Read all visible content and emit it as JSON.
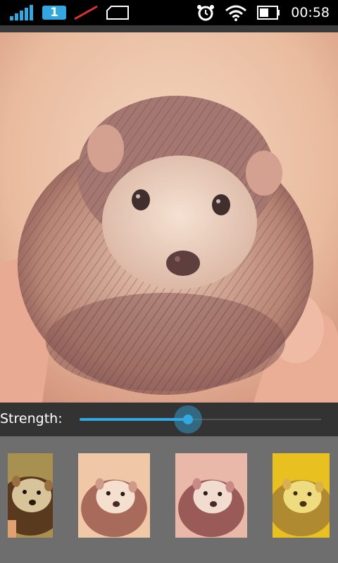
{
  "status_bar": {
    "sim_slot": "1",
    "time": "00:58",
    "icons": [
      "signal-bars-icon",
      "sim-1-icon",
      "mobile-data-off-icon",
      "sim-card-icon",
      "alarm-clock-icon",
      "wifi-icon",
      "battery-icon"
    ]
  },
  "editor": {
    "strength_label": "Strength:",
    "strength_value": 0.45
  },
  "filters": [
    {
      "name": "filter-vivid",
      "tint": "#7a5a2a"
    },
    {
      "name": "filter-warm",
      "tint": "#e8b8a0"
    },
    {
      "name": "filter-soft",
      "tint": "#e0b0a8"
    },
    {
      "name": "filter-golden",
      "tint": "#e8c020"
    }
  ],
  "colors": {
    "accent": "#33a8e0",
    "status_bar": "#000000",
    "slider_bg": "#333333",
    "strip_bg": "#6e6e6e"
  }
}
